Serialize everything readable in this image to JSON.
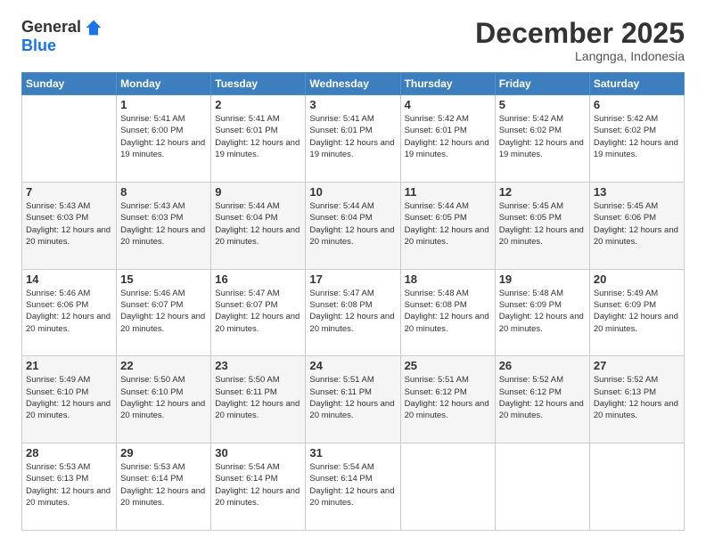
{
  "logo": {
    "general": "General",
    "blue": "Blue"
  },
  "header": {
    "month": "December 2025",
    "location": "Langnga, Indonesia"
  },
  "days_of_week": [
    "Sunday",
    "Monday",
    "Tuesday",
    "Wednesday",
    "Thursday",
    "Friday",
    "Saturday"
  ],
  "weeks": [
    [
      {
        "day": "",
        "sunrise": "",
        "sunset": "",
        "daylight": ""
      },
      {
        "day": "1",
        "sunrise": "Sunrise: 5:41 AM",
        "sunset": "Sunset: 6:00 PM",
        "daylight": "Daylight: 12 hours and 19 minutes."
      },
      {
        "day": "2",
        "sunrise": "Sunrise: 5:41 AM",
        "sunset": "Sunset: 6:01 PM",
        "daylight": "Daylight: 12 hours and 19 minutes."
      },
      {
        "day": "3",
        "sunrise": "Sunrise: 5:41 AM",
        "sunset": "Sunset: 6:01 PM",
        "daylight": "Daylight: 12 hours and 19 minutes."
      },
      {
        "day": "4",
        "sunrise": "Sunrise: 5:42 AM",
        "sunset": "Sunset: 6:01 PM",
        "daylight": "Daylight: 12 hours and 19 minutes."
      },
      {
        "day": "5",
        "sunrise": "Sunrise: 5:42 AM",
        "sunset": "Sunset: 6:02 PM",
        "daylight": "Daylight: 12 hours and 19 minutes."
      },
      {
        "day": "6",
        "sunrise": "Sunrise: 5:42 AM",
        "sunset": "Sunset: 6:02 PM",
        "daylight": "Daylight: 12 hours and 19 minutes."
      }
    ],
    [
      {
        "day": "7",
        "sunrise": "Sunrise: 5:43 AM",
        "sunset": "Sunset: 6:03 PM",
        "daylight": "Daylight: 12 hours and 20 minutes."
      },
      {
        "day": "8",
        "sunrise": "Sunrise: 5:43 AM",
        "sunset": "Sunset: 6:03 PM",
        "daylight": "Daylight: 12 hours and 20 minutes."
      },
      {
        "day": "9",
        "sunrise": "Sunrise: 5:44 AM",
        "sunset": "Sunset: 6:04 PM",
        "daylight": "Daylight: 12 hours and 20 minutes."
      },
      {
        "day": "10",
        "sunrise": "Sunrise: 5:44 AM",
        "sunset": "Sunset: 6:04 PM",
        "daylight": "Daylight: 12 hours and 20 minutes."
      },
      {
        "day": "11",
        "sunrise": "Sunrise: 5:44 AM",
        "sunset": "Sunset: 6:05 PM",
        "daylight": "Daylight: 12 hours and 20 minutes."
      },
      {
        "day": "12",
        "sunrise": "Sunrise: 5:45 AM",
        "sunset": "Sunset: 6:05 PM",
        "daylight": "Daylight: 12 hours and 20 minutes."
      },
      {
        "day": "13",
        "sunrise": "Sunrise: 5:45 AM",
        "sunset": "Sunset: 6:06 PM",
        "daylight": "Daylight: 12 hours and 20 minutes."
      }
    ],
    [
      {
        "day": "14",
        "sunrise": "Sunrise: 5:46 AM",
        "sunset": "Sunset: 6:06 PM",
        "daylight": "Daylight: 12 hours and 20 minutes."
      },
      {
        "day": "15",
        "sunrise": "Sunrise: 5:46 AM",
        "sunset": "Sunset: 6:07 PM",
        "daylight": "Daylight: 12 hours and 20 minutes."
      },
      {
        "day": "16",
        "sunrise": "Sunrise: 5:47 AM",
        "sunset": "Sunset: 6:07 PM",
        "daylight": "Daylight: 12 hours and 20 minutes."
      },
      {
        "day": "17",
        "sunrise": "Sunrise: 5:47 AM",
        "sunset": "Sunset: 6:08 PM",
        "daylight": "Daylight: 12 hours and 20 minutes."
      },
      {
        "day": "18",
        "sunrise": "Sunrise: 5:48 AM",
        "sunset": "Sunset: 6:08 PM",
        "daylight": "Daylight: 12 hours and 20 minutes."
      },
      {
        "day": "19",
        "sunrise": "Sunrise: 5:48 AM",
        "sunset": "Sunset: 6:09 PM",
        "daylight": "Daylight: 12 hours and 20 minutes."
      },
      {
        "day": "20",
        "sunrise": "Sunrise: 5:49 AM",
        "sunset": "Sunset: 6:09 PM",
        "daylight": "Daylight: 12 hours and 20 minutes."
      }
    ],
    [
      {
        "day": "21",
        "sunrise": "Sunrise: 5:49 AM",
        "sunset": "Sunset: 6:10 PM",
        "daylight": "Daylight: 12 hours and 20 minutes."
      },
      {
        "day": "22",
        "sunrise": "Sunrise: 5:50 AM",
        "sunset": "Sunset: 6:10 PM",
        "daylight": "Daylight: 12 hours and 20 minutes."
      },
      {
        "day": "23",
        "sunrise": "Sunrise: 5:50 AM",
        "sunset": "Sunset: 6:11 PM",
        "daylight": "Daylight: 12 hours and 20 minutes."
      },
      {
        "day": "24",
        "sunrise": "Sunrise: 5:51 AM",
        "sunset": "Sunset: 6:11 PM",
        "daylight": "Daylight: 12 hours and 20 minutes."
      },
      {
        "day": "25",
        "sunrise": "Sunrise: 5:51 AM",
        "sunset": "Sunset: 6:12 PM",
        "daylight": "Daylight: 12 hours and 20 minutes."
      },
      {
        "day": "26",
        "sunrise": "Sunrise: 5:52 AM",
        "sunset": "Sunset: 6:12 PM",
        "daylight": "Daylight: 12 hours and 20 minutes."
      },
      {
        "day": "27",
        "sunrise": "Sunrise: 5:52 AM",
        "sunset": "Sunset: 6:13 PM",
        "daylight": "Daylight: 12 hours and 20 minutes."
      }
    ],
    [
      {
        "day": "28",
        "sunrise": "Sunrise: 5:53 AM",
        "sunset": "Sunset: 6:13 PM",
        "daylight": "Daylight: 12 hours and 20 minutes."
      },
      {
        "day": "29",
        "sunrise": "Sunrise: 5:53 AM",
        "sunset": "Sunset: 6:14 PM",
        "daylight": "Daylight: 12 hours and 20 minutes."
      },
      {
        "day": "30",
        "sunrise": "Sunrise: 5:54 AM",
        "sunset": "Sunset: 6:14 PM",
        "daylight": "Daylight: 12 hours and 20 minutes."
      },
      {
        "day": "31",
        "sunrise": "Sunrise: 5:54 AM",
        "sunset": "Sunset: 6:14 PM",
        "daylight": "Daylight: 12 hours and 20 minutes."
      },
      {
        "day": "",
        "sunrise": "",
        "sunset": "",
        "daylight": ""
      },
      {
        "day": "",
        "sunrise": "",
        "sunset": "",
        "daylight": ""
      },
      {
        "day": "",
        "sunrise": "",
        "sunset": "",
        "daylight": ""
      }
    ]
  ]
}
